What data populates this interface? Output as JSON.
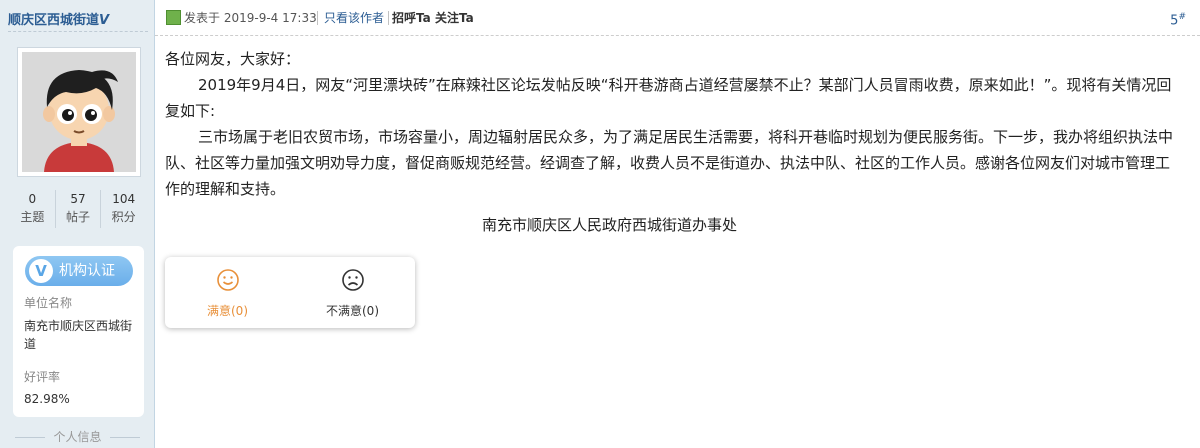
{
  "author": {
    "name": "顺庆区西城街道",
    "verified_badge": "V",
    "stats": [
      {
        "value": "0",
        "label": "主题"
      },
      {
        "value": "57",
        "label": "帖子"
      },
      {
        "value": "104",
        "label": "积分"
      }
    ],
    "certification": {
      "badge_icon": "V",
      "badge_label": "机构认证",
      "unit_label": "单位名称",
      "unit_value": "南充市顺庆区西城街道",
      "rating_label": "好评率",
      "rating_value": "82.98%"
    },
    "personal_info_label": "个人信息"
  },
  "post": {
    "posted_prefix": "发表于",
    "posted_time": "2019-9-4 17:33",
    "only_author_label": "只看该作者",
    "greet_label": "招呼Ta",
    "follow_label": "关注Ta",
    "floor": "5",
    "floor_mark": "#",
    "paragraphs": [
      "各位网友，大家好：",
      "2019年9月4日，网友“河里漂块砖”在麻辣社区论坛发帖反映“科开巷游商占道经营屡禁不止？某部门人员冒雨收费，原来如此！”。现将有关情况回复如下:",
      "三市场属于老旧农贸市场，市场容量小，周边辐射居民众多，为了满足居民生活需要，将科开巷临时规划为便民服务街。下一步，我办将组织执法中队、社区等力量加强文明劝导力度，督促商贩规范经营。经调查了解，收费人员不是街道办、执法中队、社区的工作人员。感谢各位网友们对城市管理工作的理解和支持。"
    ],
    "signature": "南充市顺庆区人民政府西城街道办事处"
  },
  "rating": {
    "satisfied_label": "满意(0)",
    "unsatisfied_label": "不满意(0)",
    "satisfied_color": "#e8903a"
  }
}
